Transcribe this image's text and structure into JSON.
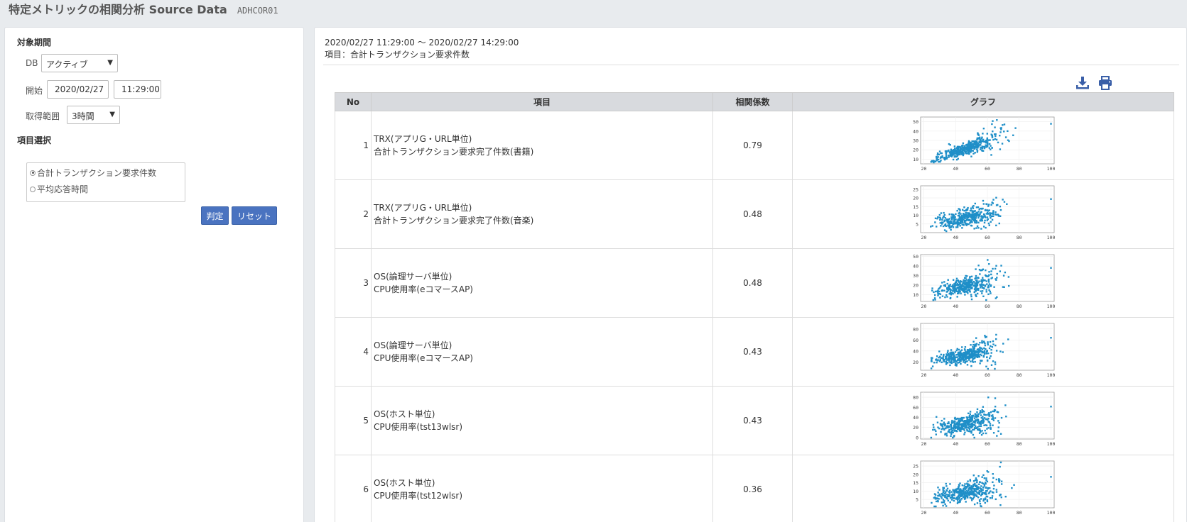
{
  "header": {
    "title": "特定メトリックの相関分析 Source Data",
    "code": "ADHCOR01"
  },
  "sidebar": {
    "period_label": "対象期間",
    "db_label": "DB",
    "db_value": "アクティブ",
    "start_label": "開始",
    "start_date": "2020/02/27",
    "start_time": "11:29:00",
    "range_label": "取得範囲",
    "range_value": "3時間",
    "item_select_label": "項目選択",
    "options": [
      "合計トランザクション要求件数",
      "平均応答時間"
    ],
    "selected_option": 0,
    "judge_button": "判定",
    "reset_button": "リセット"
  },
  "main": {
    "range_text": "2020/02/27 11:29:00 〜 2020/02/27 14:29:00",
    "item_text": "項目：合計トランザクション要求件数",
    "icons": [
      "download-icon",
      "print-icon"
    ],
    "columns": [
      "No",
      "項目",
      "相関係数",
      "グラフ"
    ],
    "rows": [
      {
        "no": "1",
        "line1": "TRX(アプリG・URL単位)",
        "line2": "合計トランザクション要求完了件数(書籍)",
        "coef": "0.79",
        "chart": {
          "yticks": [
            "50",
            "40",
            "30",
            "20",
            "10"
          ],
          "xticks": [
            "20",
            "40",
            "60",
            "80",
            "100"
          ],
          "r": 0.79,
          "ymin": 5,
          "ymax": 55,
          "seed": 11
        }
      },
      {
        "no": "2",
        "line1": "TRX(アプリG・URL単位)",
        "line2": "合計トランザクション要求完了件数(音楽)",
        "coef": "0.48",
        "chart": {
          "yticks": [
            "25",
            "20",
            "15",
            "10",
            "5"
          ],
          "xticks": [
            "20",
            "40",
            "60",
            "80",
            "100"
          ],
          "r": 0.48,
          "ymin": 0,
          "ymax": 27,
          "seed": 23
        }
      },
      {
        "no": "3",
        "line1": "OS(論理サーバ単位)",
        "line2": "CPU使用率(eコマースAP)",
        "coef": "0.48",
        "chart": {
          "yticks": [
            "50",
            "40",
            "30",
            "20",
            "10"
          ],
          "xticks": [
            "20",
            "40",
            "60",
            "80",
            "100"
          ],
          "r": 0.48,
          "ymin": 3,
          "ymax": 52,
          "seed": 37
        }
      },
      {
        "no": "4",
        "line1": "OS(論理サーバ単位)",
        "line2": "CPU使用率(eコマースAP)",
        "coef": "0.43",
        "chart": {
          "yticks": [
            "80",
            "60",
            "40",
            "20"
          ],
          "xticks": [
            "20",
            "40",
            "60",
            "80",
            "100"
          ],
          "r": 0.43,
          "ymin": 5,
          "ymax": 90,
          "seed": 41
        }
      },
      {
        "no": "5",
        "line1": "OS(ホスト単位)",
        "line2": "CPU使用率(tst13wlsr)",
        "coef": "0.43",
        "chart": {
          "yticks": [
            "80",
            "60",
            "40",
            "20",
            "0"
          ],
          "xticks": [
            "20",
            "40",
            "60",
            "80",
            "100"
          ],
          "r": 0.43,
          "ymin": -3,
          "ymax": 90,
          "seed": 53
        }
      },
      {
        "no": "6",
        "line1": "OS(ホスト単位)",
        "line2": "CPU使用率(tst12wlsr)",
        "coef": "0.36",
        "chart": {
          "yticks": [
            "25",
            "20",
            "15",
            "10",
            "5"
          ],
          "xticks": [
            "20",
            "40",
            "60",
            "80",
            "100"
          ],
          "r": 0.36,
          "ymin": 0,
          "ymax": 28,
          "seed": 67
        }
      }
    ]
  },
  "colors": {
    "accent": "#4a73c0",
    "dots": "#1f8fc8",
    "header_bg": "#d8dade"
  }
}
